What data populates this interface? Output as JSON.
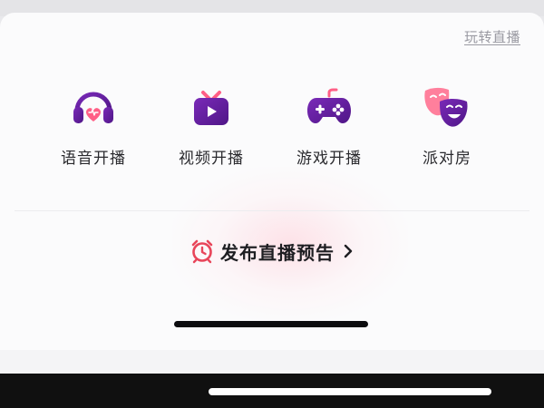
{
  "header": {
    "link_label": "玩转直播"
  },
  "options": [
    {
      "label": "语音开播",
      "icon": "headphones-icon"
    },
    {
      "label": "视频开播",
      "icon": "tv-play-icon"
    },
    {
      "label": "游戏开播",
      "icon": "gamepad-icon"
    },
    {
      "label": "派对房",
      "icon": "party-masks-icon"
    }
  ],
  "preview": {
    "label": "发布直播预告",
    "icon": "alarm-clock-icon",
    "arrow_icon": "chevron-right-icon"
  },
  "colors": {
    "accent_purple": "#6a1fa6",
    "accent_pink": "#ff5f86",
    "alarm_red": "#e8455a",
    "text_dark": "#1e1e22",
    "link_gray": "#9a9aa2"
  }
}
